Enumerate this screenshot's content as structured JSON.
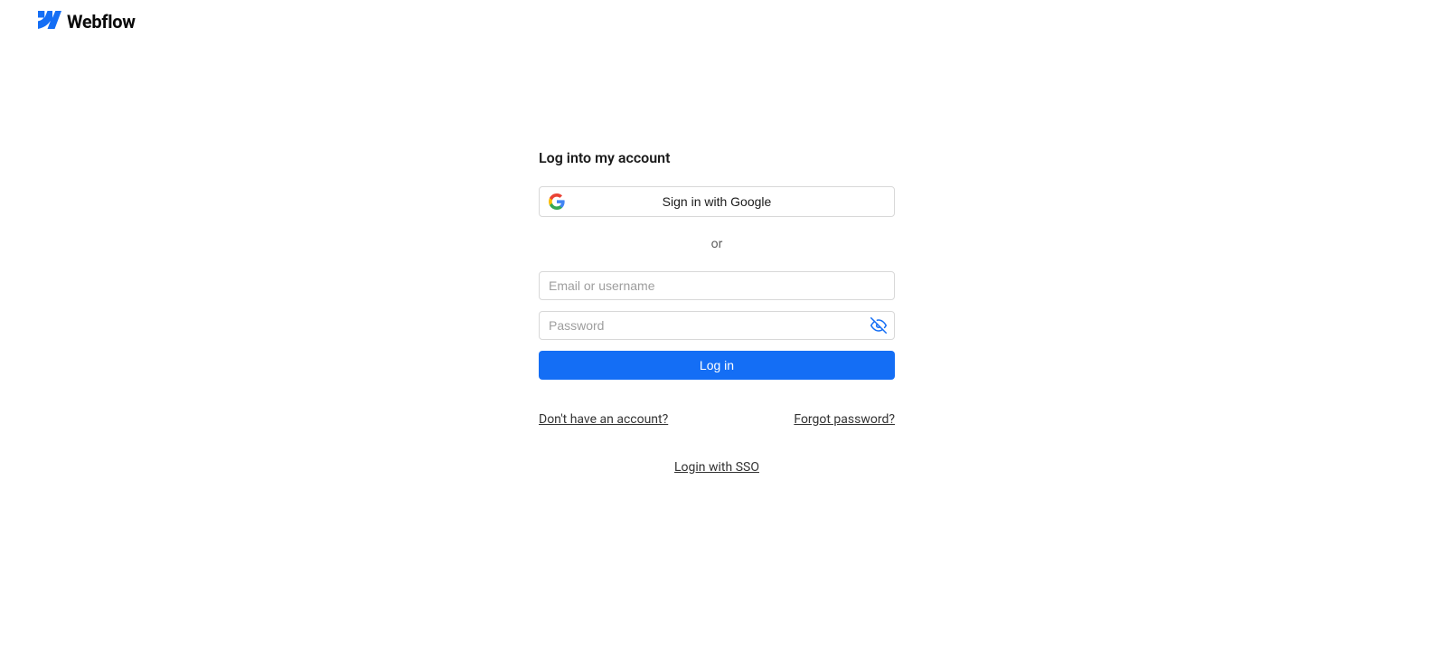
{
  "brand": {
    "name": "Webflow"
  },
  "login": {
    "title": "Log into my account",
    "google_button": "Sign in with Google",
    "divider": "or",
    "email_placeholder": "Email or username",
    "password_placeholder": "Password",
    "submit": "Log in",
    "signup_link": "Don't have an account?",
    "forgot_link": "Forgot password?",
    "sso_link": "Login with SSO"
  },
  "colors": {
    "primary": "#146ef5"
  }
}
